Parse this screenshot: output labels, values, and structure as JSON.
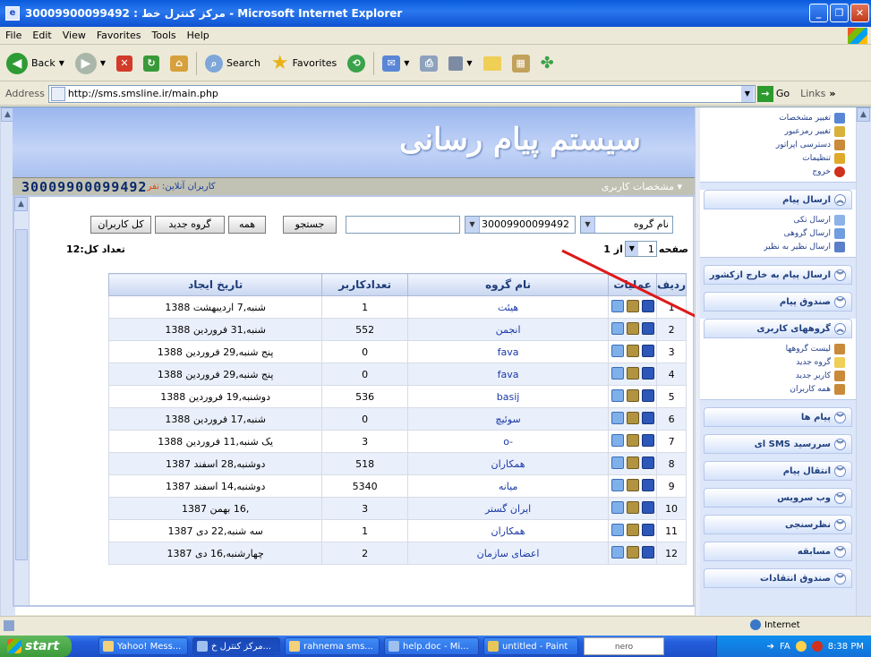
{
  "window": {
    "title": "30009900099492 : مرکز کنترل خط - Microsoft Internet Explorer"
  },
  "menu": [
    "File",
    "Edit",
    "View",
    "Favorites",
    "Tools",
    "Help"
  ],
  "toolbar": {
    "back": "Back",
    "search": "Search",
    "favorites": "Favorites"
  },
  "address": {
    "label": "Address",
    "url": "http://sms.smsline.ir/main.php",
    "go": "Go",
    "links": "Links"
  },
  "banner": {
    "title": "سیستم پیام رسانی"
  },
  "strip": {
    "phone": "30009900099492",
    "online_label": "کاربران آنلاین:",
    "online_value": "نفر",
    "header": "مشخصات کاربری"
  },
  "controls": {
    "all_users": "کل کاربران",
    "new_group": "گروه جدید",
    "all": "همه",
    "search": "جستجو",
    "line_select": "30009900099492",
    "field_select": "نام گروه",
    "total_label": "تعداد کل:12",
    "page_label": "صفحه",
    "page_value": "1",
    "page_of": "از 1"
  },
  "table": {
    "headers": {
      "row": "ردیف",
      "ops": "عملیات",
      "name": "نام گروه",
      "count": "تعدادکاربر",
      "date": "تاریخ ایجاد"
    },
    "rows": [
      {
        "n": "1",
        "name": "هیئت",
        "count": "1",
        "date": "شنبه,7 اردیبهشت 1388"
      },
      {
        "n": "2",
        "name": "انجمن",
        "count": "552",
        "date": "شنبه,31 فروردین 1388"
      },
      {
        "n": "3",
        "name": "fava",
        "count": "0",
        "date": "پنج شنبه,29 فروردین 1388"
      },
      {
        "n": "4",
        "name": "fava",
        "count": "0",
        "date": "پنج شنبه,29 فروردین 1388"
      },
      {
        "n": "5",
        "name": "basij",
        "count": "536",
        "date": "دوشنبه,19 فروردین 1388"
      },
      {
        "n": "6",
        "name": "سوئیچ",
        "count": "0",
        "date": "شنبه,17 فروردین 1388"
      },
      {
        "n": "7",
        "name": "-o",
        "count": "3",
        "date": "یک شنبه,11 فروردین 1388"
      },
      {
        "n": "8",
        "name": "همکاران",
        "count": "518",
        "date": "دوشنبه,28 اسفند 1387"
      },
      {
        "n": "9",
        "name": "میانه",
        "count": "5340",
        "date": "دوشنبه,14 اسفند 1387"
      },
      {
        "n": "10",
        "name": "ایران گستر",
        "count": "3",
        "date": ",16 بهمن 1387"
      },
      {
        "n": "11",
        "name": "همکاران",
        "count": "1",
        "date": "سه شنبه,22 دی 1387"
      },
      {
        "n": "12",
        "name": "اعضای سازمان",
        "count": "2",
        "date": "چهارشنبه,16 دی 1387"
      }
    ]
  },
  "sidebar": {
    "top_items": [
      {
        "label": "تغییر مشخصات",
        "icon": "profile-icon",
        "color": "#5a86d6"
      },
      {
        "label": "تغییر رمزعبور",
        "icon": "key-icon",
        "color": "#d8b13a"
      },
      {
        "label": "دسترسی اپراتور",
        "icon": "operator-icon",
        "color": "#c98a3a"
      },
      {
        "label": "تنظیمات",
        "icon": "settings-icon",
        "color": "#e0a92b"
      },
      {
        "label": "خروج",
        "icon": "exit-icon",
        "color": "#d0301c"
      }
    ],
    "send_group": {
      "title": "ارسال پیام",
      "items": [
        "ارسال تکی",
        "ارسال گروهی",
        "ارسال نظیر به نظیر"
      ]
    },
    "intl": "ارسال پیام به خارج ازکشور",
    "inbox": "صندوق پیام",
    "user_groups": {
      "title": "گروههای کاربری",
      "items": [
        "لیست گروهها",
        "گروه جدید",
        "کاربر جدید",
        "همه کاربران"
      ]
    },
    "others": [
      "پیام ها",
      "سررسید SMS ای",
      "انتقال پیام",
      "وب سرویس",
      "نظرسنجی",
      "مسابقه",
      "صندوق انتقادات"
    ]
  },
  "statusbar": {
    "zone": "Internet"
  },
  "taskbar": {
    "start": "start",
    "tasks": [
      "Yahoo! Mess...",
      "مرکز کنترل خ...",
      "rahnema sms...",
      "help.doc - Mi...",
      "untitled - Paint"
    ],
    "nero": "nero",
    "lang": "FA",
    "clock": "8:38 PM"
  }
}
